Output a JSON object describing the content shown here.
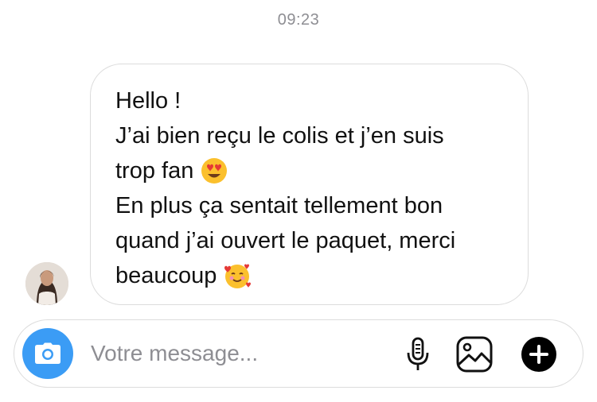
{
  "header": {
    "timestamp": "09:23"
  },
  "message": {
    "lines": [
      "Hello !",
      "J’ai bien reçu le colis et j’en suis",
      "trop fan",
      "En plus ça sentait tellement bon",
      "quand j’ai ouvert le paquet, merci",
      "beaucoup"
    ],
    "emojis": [
      "heart-eyes-emoji",
      "smiling-face-with-hearts-emoji"
    ]
  },
  "composer": {
    "placeholder": "Votre message...",
    "icons": [
      "camera-icon",
      "microphone-icon",
      "gallery-icon",
      "plus-icon"
    ],
    "accent_color": "#3b9cf5"
  }
}
